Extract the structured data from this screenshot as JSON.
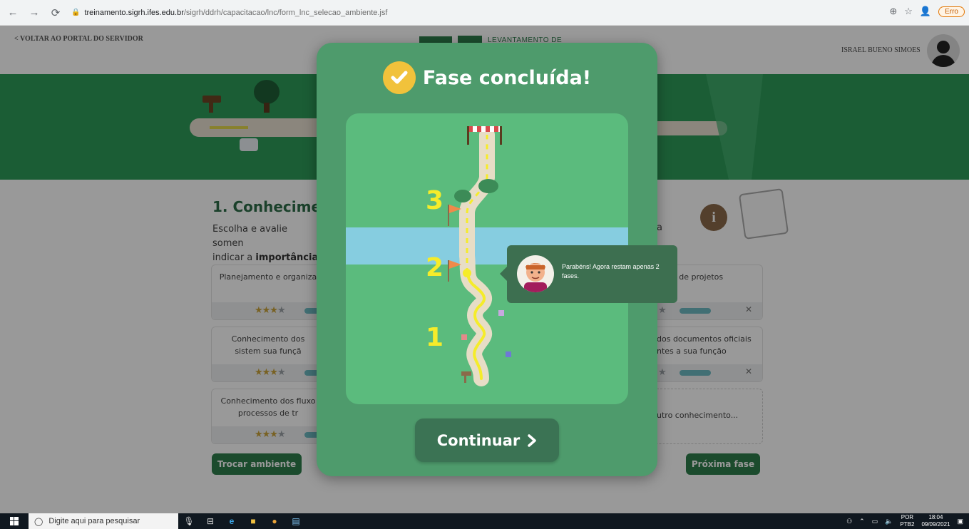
{
  "browser": {
    "url_host": "treinamento.sigrh.ifes.edu.br",
    "url_path": "/sigrh/ddrh/capacitacao/lnc/form_lnc_selecao_ambiente.jsf",
    "error_label": "Erro"
  },
  "header": {
    "back_link": "< VOLTAR AO PORTAL DO SERVIDOR",
    "logo_text": "LEVANTAMENTO DE",
    "user_name": "ISRAEL BUENO SIMOES"
  },
  "section": {
    "title": "1. Conhecimen",
    "desc_line1": "Escolha e avalie somen",
    "desc_line2_prefix": "indicar a ",
    "desc_line2_bold": "importância",
    "desc_tail": "a"
  },
  "cards": [
    {
      "text": "Planejamento e organiza"
    },
    {
      "text": "tão de projetos"
    },
    {
      "text": "Conhecimento dos sistem sua funçã"
    },
    {
      "text": "dos documentos oficiais ntes a sua função"
    },
    {
      "text": "Conhecimento dos fluxo processos de tr"
    },
    {
      "text": "utro conhecimento..."
    }
  ],
  "buttons": {
    "change_env": "Trocar ambiente",
    "next_phase": "Próxima fase"
  },
  "modal": {
    "title": "Fase concluída!",
    "continue_label": "Continuar",
    "phase_numbers": [
      "1",
      "2",
      "3"
    ],
    "tooltip": "Parabéns! Agora restam apenas 2 fases.",
    "colors": {
      "modal_bg": "#4e9b6c",
      "map_bg": "#5bbb7d",
      "river": "#86cde0",
      "path": "#e7ddc6",
      "path_line": "#f5ec2a",
      "check": "#f1c23b"
    }
  },
  "taskbar": {
    "search_placeholder": "Digite aqui para pesquisar",
    "lang_top": "POR",
    "lang_bottom": "PTB2",
    "time": "18:04",
    "date": "09/09/2021"
  }
}
